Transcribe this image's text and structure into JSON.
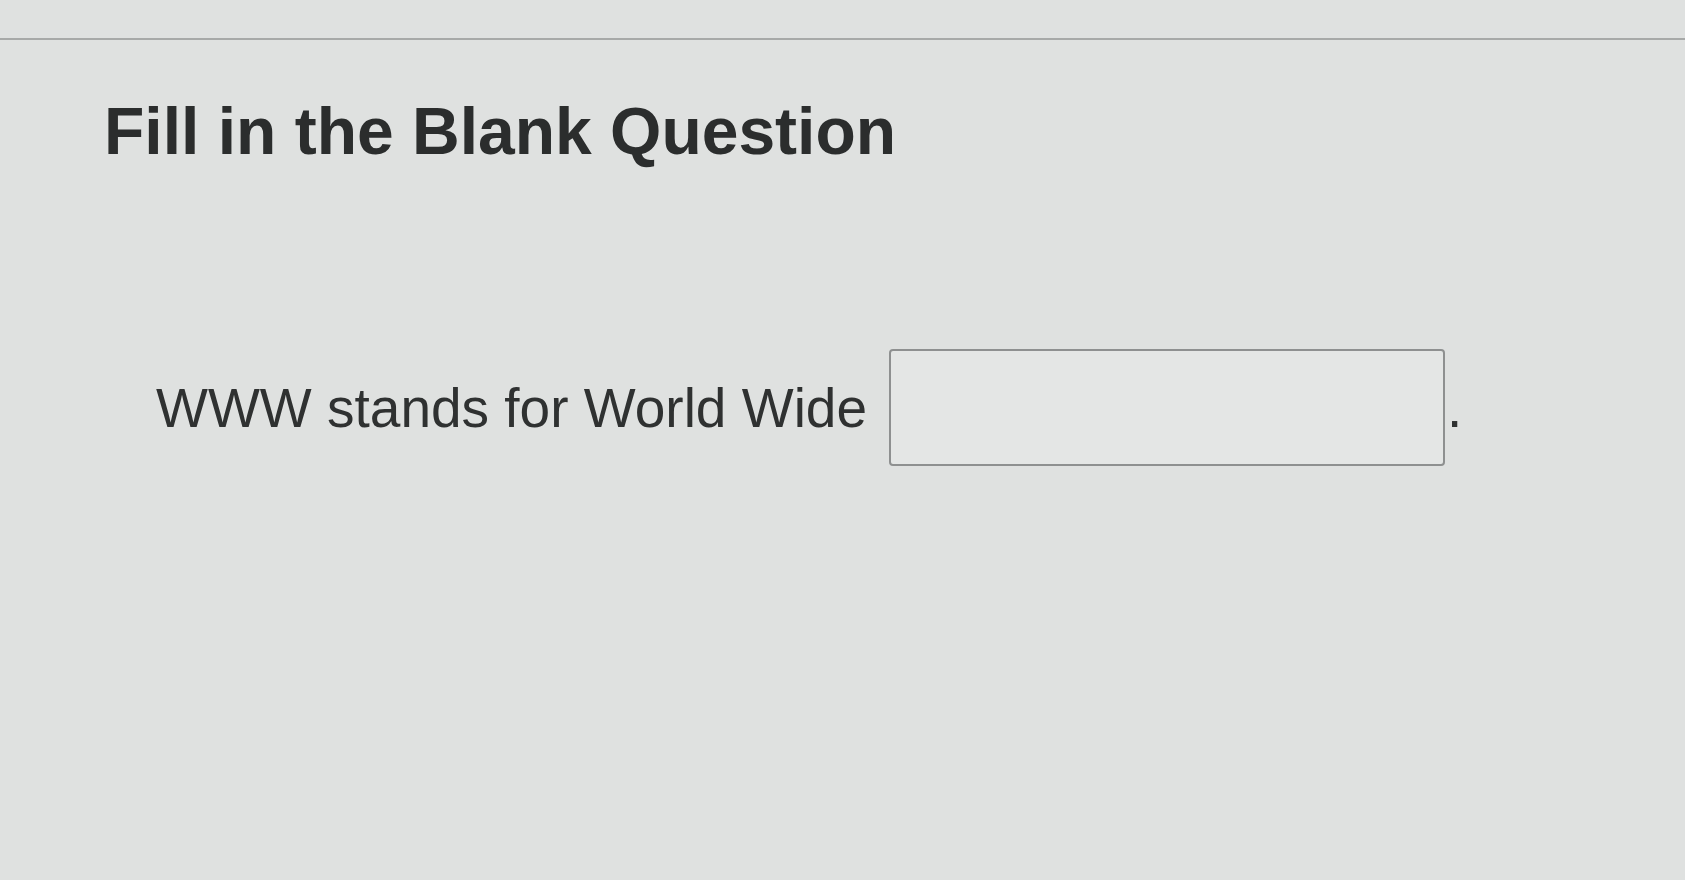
{
  "heading": "Fill in the Blank Question",
  "question": {
    "parts": [
      {
        "kind": "text",
        "text": "WWW stands for World Wide"
      },
      {
        "kind": "blank"
      },
      {
        "kind": "punctuation",
        "text": "."
      }
    ]
  }
}
